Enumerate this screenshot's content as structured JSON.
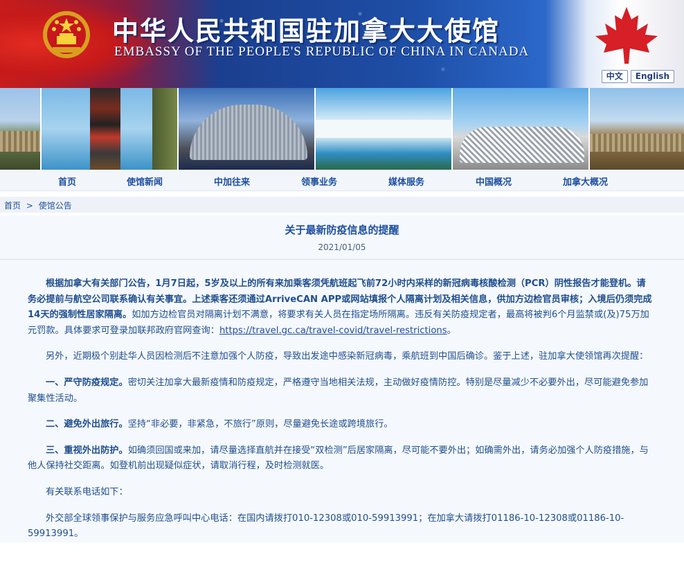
{
  "header": {
    "title_cn": "中华人民共和国驻加拿大大使馆",
    "title_en": "EMBASSY OF THE PEOPLE'S REPUBLIC OF CHINA IN CANADA",
    "lang_cn": "中文",
    "lang_en": "English"
  },
  "nav": {
    "items": [
      {
        "label": "首页"
      },
      {
        "label": "使馆新闻"
      },
      {
        "label": "中加往来"
      },
      {
        "label": "领事业务"
      },
      {
        "label": "媒体服务"
      },
      {
        "label": "中国概况"
      },
      {
        "label": "加拿大概况"
      }
    ]
  },
  "breadcrumb": {
    "home": "首页",
    "sep": ">",
    "current": "使馆公告"
  },
  "article": {
    "title": "关于最新防疫信息的提醒",
    "date": "2021/01/05",
    "p1_bold": "根据加拿大有关部门公告，1月7日起，5岁及以上的所有来加乘客须凭航班起飞前72小时内采样的新冠病毒核酸检测（PCR）阴性报告才能登机。请务必提前与航空公司联系确认有关事宜。上述乘客还须通过ArriveCAN APP或网站填报个人隔离计划及相关信息，供加方边检官员审核；入境后仍须完成14天的强制性居家隔离。",
    "p1_rest": "如加方边检官员对隔离计划不满意，将要求有关人员在指定场所隔离。违反有关防疫规定者，最高将被判6个月监禁或(及)75万加元罚款。具体要求可登录加联邦政府官网查询：",
    "p1_link": "https://travel.gc.ca/travel-covid/travel-restrictions",
    "p1_end": "。",
    "p2": "另外，近期极个别赴华人员因检测后不注意加强个人防疫，导致出发途中感染新冠病毒，乘航班到中国后确诊。鉴于上述，驻加拿大使领馆再次提醒：",
    "p3_bold": "一、严守防疫规定。",
    "p3_rest": "密切关注加拿大最新疫情和防疫规定，严格遵守当地相关法规，主动做好疫情防控。特别是尽量减少不必要外出，尽可能避免参加聚集性活动。",
    "p4_bold": "二、避免外出旅行。",
    "p4_rest": "坚持“非必要，非紧急，不旅行”原则，尽量避免长途或跨境旅行。",
    "p5_bold": "三、重视外出防护。",
    "p5_rest": "如确须回国或来加，请尽量选择直航并在接受“双检测”后居家隔离，尽可能不要外出；如确需外出，请务必加强个人防疫措施，与他人保持社交距离。如登机前出现疑似症状，请取消行程，及时检测就医。",
    "p6": "有关联系电话如下：",
    "p7": "外交部全球领事保护与服务应急呼叫中心电话：在国内请拨打010-12308或010-59913991；在加拿大请拨打01186-10-12308或01186-10-59913991。"
  },
  "colors": {
    "link_blue": "#1e4fa0",
    "banner_red": "#c81d1a",
    "banner_blue": "#1e4ea6"
  }
}
